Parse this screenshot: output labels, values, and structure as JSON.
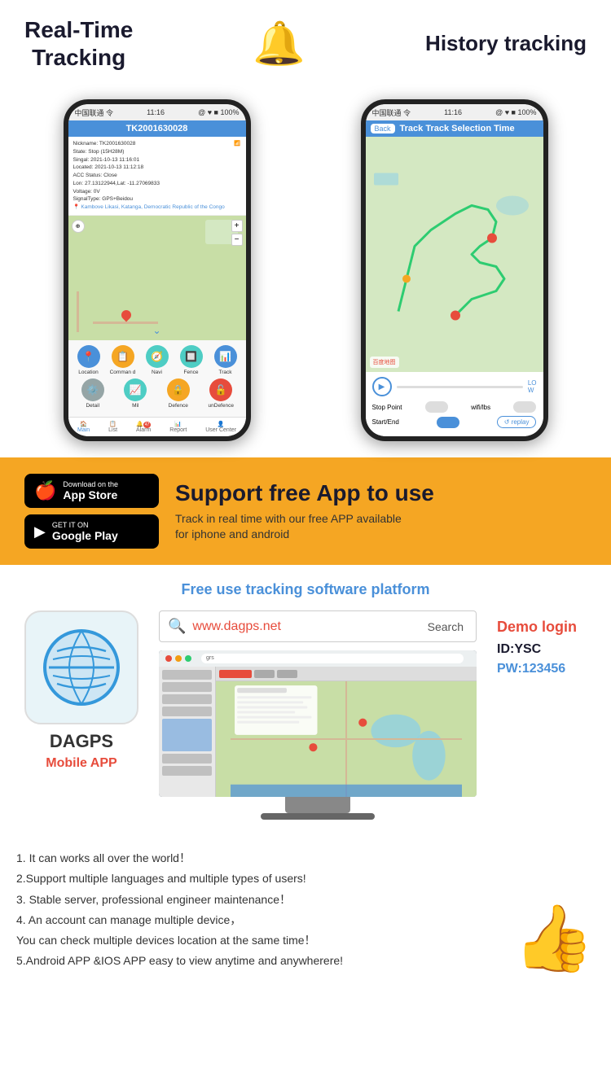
{
  "header": {
    "real_time_title": "Real-Time\nTracking",
    "history_title": "History tracking"
  },
  "phone1": {
    "status_carrier": "中国联通 令",
    "status_time": "11:16",
    "status_icons": "@ ♥ ■ 100%",
    "title": "TK2001630028",
    "info_lines": [
      "Nickname: TK2001630028",
      "State: Stop (15H28M)",
      "Singal: 2021-10-13 11:16:01",
      "Located: 2021-10-13 11:12:18",
      "ACC Status: Close",
      "Lon: 27.13122944,Lat:",
      "-11.27069833",
      "Voltage: 0V",
      "SignalType: GPS+Beidou"
    ],
    "location_label": "Kambove Likasi, Katanga, Democratic Republic of the Congo",
    "action_buttons": [
      "Location",
      "Command",
      "Navi",
      "Fence",
      "Track",
      "Detail",
      "Mil",
      "Defence",
      "unDefence"
    ],
    "nav_items": [
      "Main",
      "List",
      "Alarm",
      "Report",
      "User Center"
    ]
  },
  "phone2": {
    "status_carrier": "中国联通 令",
    "status_time": "11:16",
    "status_icons": "@ ♥ ■ 100%",
    "back_label": "Back",
    "title": "Track Selection Time",
    "stop_point_label": "Stop Point",
    "wifi_lbs_label": "wifi/lbs",
    "start_end_label": "Start/End",
    "replay_label": "↺ replay",
    "speed_label": "LO\nW"
  },
  "banner": {
    "app_store_small": "Download on the",
    "app_store_big": "App Store",
    "google_play_small": "GET IT ON",
    "google_play_big": "Google Play",
    "main_text": "Support free App to use",
    "sub_text": "Track in real time with our free APP available\nfor iphone and android"
  },
  "platform": {
    "title": "Free use tracking software platform",
    "search_placeholder": "www.dagps.net",
    "search_button": "Search",
    "app_name": "DAGPS",
    "mobile_app_label": "Mobile APP",
    "demo": {
      "title": "Demo login",
      "id_label": "ID:YSC",
      "pw_label": "PW:123456"
    }
  },
  "features": {
    "items": [
      "1. It can works all over the world！",
      "2.Support multiple languages and multiple types of users!",
      "3. Stable server, professional engineer maintenance！",
      "4. An account can manage multiple device，",
      "You can check multiple devices location at the same time！",
      "5.Android APP &IOS APP easy to view anytime and anywherere!"
    ]
  }
}
